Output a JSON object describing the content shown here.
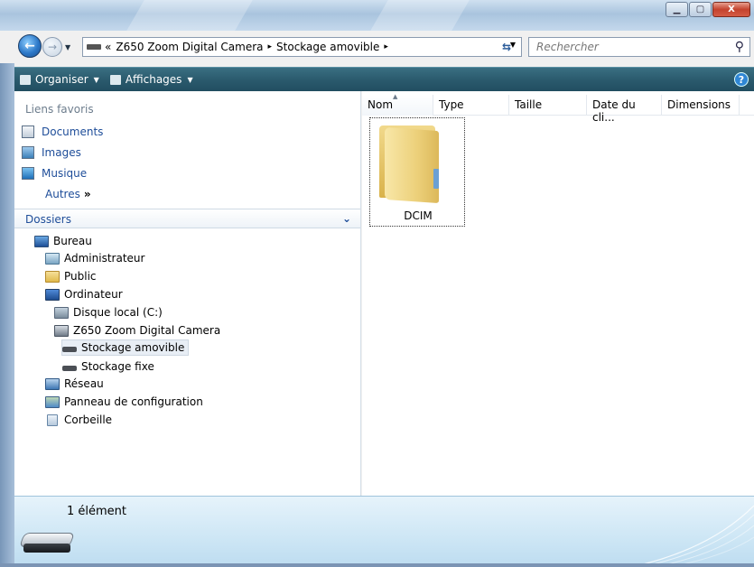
{
  "window": {
    "minimize_icon": "minimize-icon",
    "maximize_icon": "maximize-icon",
    "close_glyph": "X"
  },
  "address": {
    "overflow": "«",
    "path": [
      "Z650 Zoom Digital Camera",
      "Stockage amovible"
    ],
    "separator": "▸"
  },
  "search": {
    "placeholder": "Rechercher",
    "icon": "search-icon"
  },
  "toolbar": {
    "organize": "Organiser",
    "views": "Affichages",
    "help_glyph": "?"
  },
  "navpane": {
    "favorites_title": "Liens favoris",
    "favorites": [
      {
        "label": "Documents",
        "icon": "documents-icon"
      },
      {
        "label": "Images",
        "icon": "images-icon"
      },
      {
        "label": "Musique",
        "icon": "music-icon"
      }
    ],
    "more": "Autres",
    "more_glyph": "»",
    "folders_title": "Dossiers",
    "tree": [
      {
        "label": "Bureau",
        "icon": "desktop-icon",
        "indent": 0
      },
      {
        "label": "Administrateur",
        "icon": "user-folder-icon",
        "indent": 1
      },
      {
        "label": "Public",
        "icon": "folder-icon",
        "indent": 1
      },
      {
        "label": "Ordinateur",
        "icon": "computer-icon",
        "indent": 1
      },
      {
        "label": "Disque local (C:)",
        "icon": "hard-drive-icon",
        "indent": 2
      },
      {
        "label": "Z650 Zoom Digital Camera",
        "icon": "camera-icon",
        "indent": 2
      },
      {
        "label": "Stockage amovible",
        "icon": "removable-drive-icon",
        "indent": 3,
        "selected": true
      },
      {
        "label": "Stockage fixe",
        "icon": "fixed-drive-icon",
        "indent": 3
      },
      {
        "label": "Réseau",
        "icon": "network-icon",
        "indent": 1
      },
      {
        "label": "Panneau de configuration",
        "icon": "control-panel-icon",
        "indent": 1
      },
      {
        "label": "Corbeille",
        "icon": "recycle-bin-icon",
        "indent": 1
      }
    ]
  },
  "content": {
    "columns": [
      "Nom",
      "Type",
      "Taille",
      "Date du cli...",
      "Dimensions"
    ],
    "items": [
      {
        "name": "DCIM",
        "icon": "folder-icon"
      }
    ]
  },
  "details": {
    "count": "1 élément",
    "icon": "removable-drive-icon"
  },
  "colors": {
    "toolbar": "#2b5b6e",
    "link": "#1e4d99",
    "details_bg": "#cde6f5"
  }
}
